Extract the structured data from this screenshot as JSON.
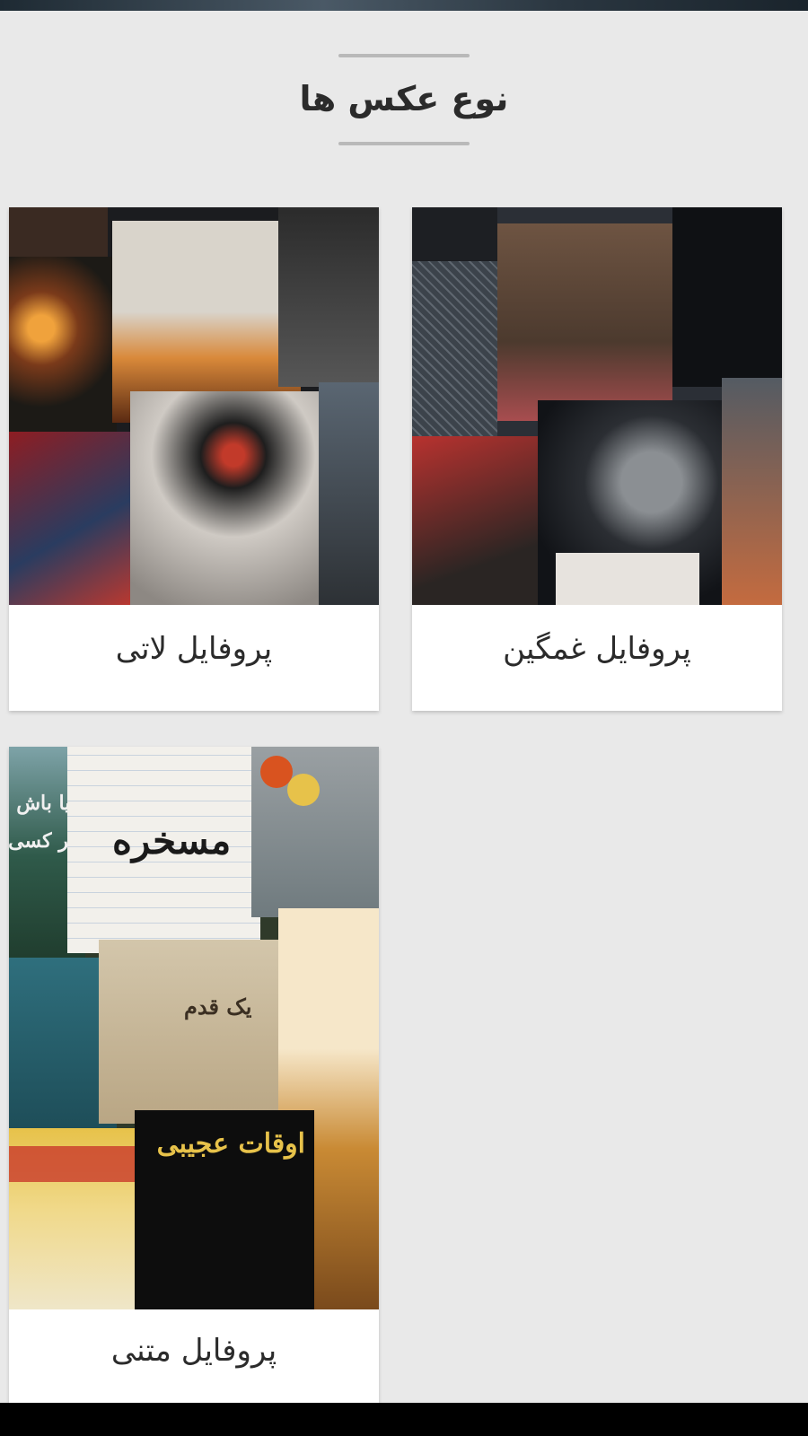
{
  "header": {
    "title": "نوع عکس ها"
  },
  "categories": [
    {
      "label": "پروفایل غمگین",
      "image_icon": "sad-profile-collage",
      "colors": [
        "#2b2f36",
        "#7a5b45",
        "#111317",
        "#b8322f",
        "#e7e3de",
        "#545b63"
      ]
    },
    {
      "label": "پروفایل لاتی",
      "image_icon": "tough-profile-collage",
      "colors": [
        "#3a2a22",
        "#d9893a",
        "#1b1c1f",
        "#8e1d22",
        "#cfcac4",
        "#5a6672"
      ]
    },
    {
      "label": "پروفایل متنی",
      "image_icon": "text-profile-collage",
      "snippets": [
        "مسخره",
        "یک قدم",
        "اوقات عجیبی",
        "ریا باش",
        "هر کسی"
      ],
      "colors": [
        "#f2f0eb",
        "#cdb58a",
        "#0d0d0d",
        "#e7c24a",
        "#2f6f7d",
        "#c93a2b"
      ]
    }
  ],
  "accent_colors": {
    "rule": "#b9b9b9",
    "text": "#2b2b2b",
    "background": "#e9e9e9"
  }
}
